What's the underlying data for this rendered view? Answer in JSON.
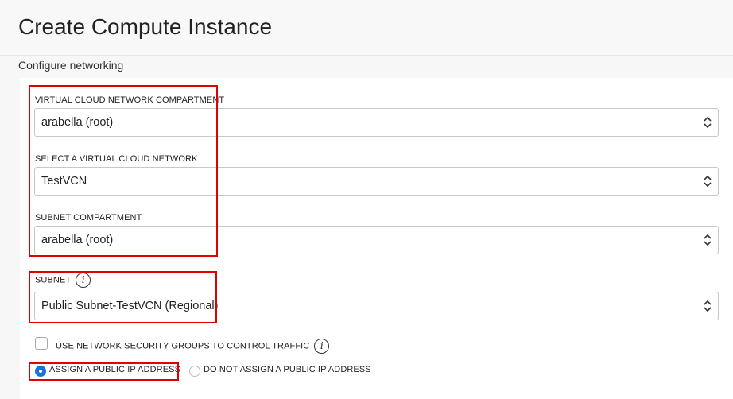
{
  "header": {
    "title": "Create Compute Instance"
  },
  "section": {
    "title": "Configure networking"
  },
  "fields": {
    "vcn_compartment": {
      "label": "VIRTUAL CLOUD NETWORK COMPARTMENT",
      "value": "arabella (root)"
    },
    "vcn": {
      "label": "SELECT A VIRTUAL CLOUD NETWORK",
      "value": "TestVCN"
    },
    "subnet_compartment": {
      "label": "SUBNET COMPARTMENT",
      "value": "arabella (root)"
    },
    "subnet": {
      "label": "SUBNET",
      "value": "Public Subnet-TestVCN (Regional)"
    }
  },
  "nsg": {
    "label": "USE NETWORK SECURITY GROUPS TO CONTROL TRAFFIC",
    "checked": false
  },
  "public_ip": {
    "assign_label": "ASSIGN A PUBLIC IP ADDRESS",
    "no_assign_label": "DO NOT ASSIGN A PUBLIC IP ADDRESS",
    "selected": "assign"
  },
  "colors": {
    "highlight": "#e00000",
    "accent": "#1a73d9"
  }
}
